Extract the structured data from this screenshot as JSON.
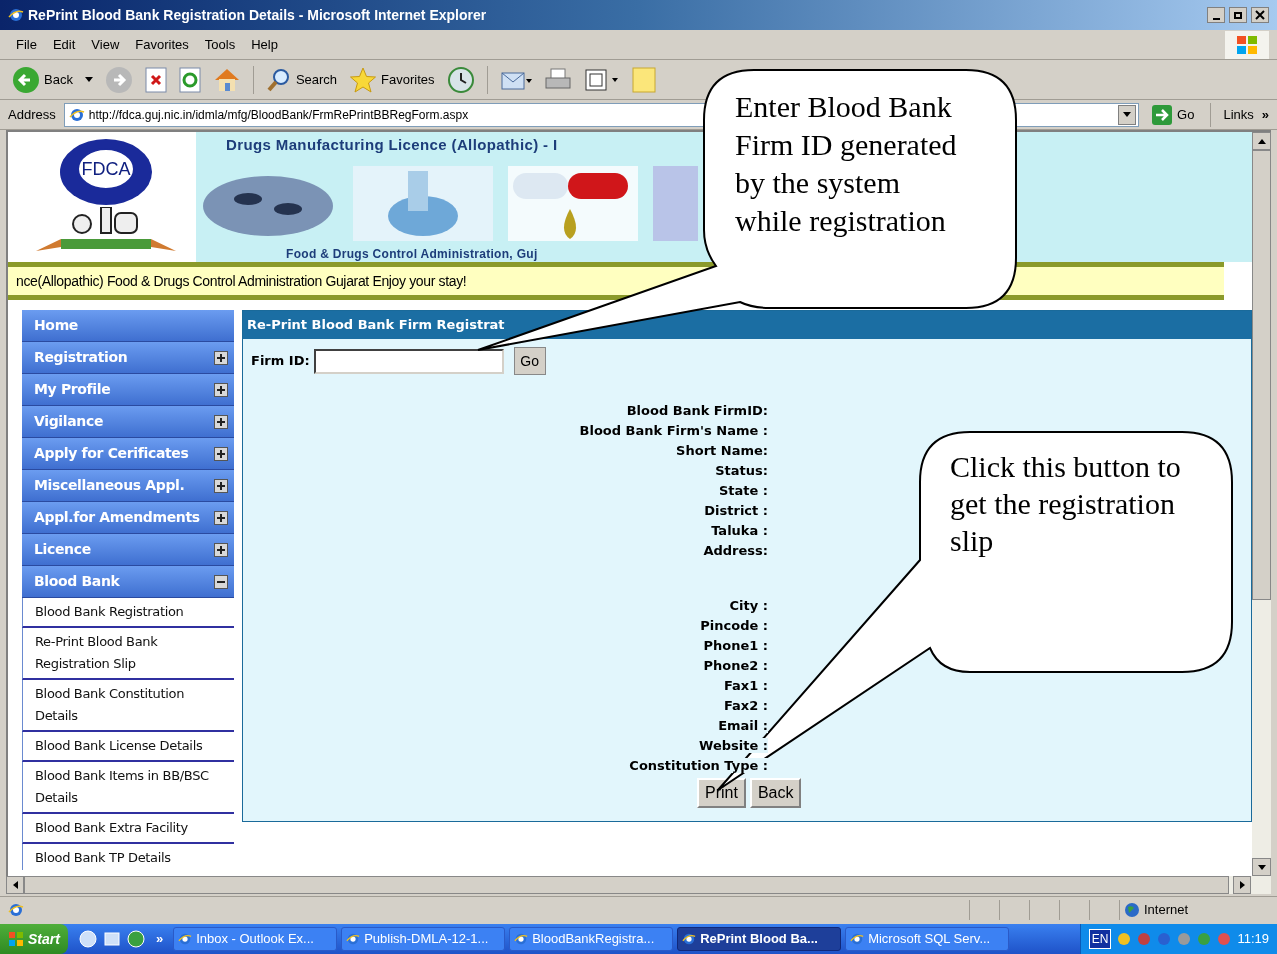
{
  "window": {
    "title": "RePrint Blood Bank Registration Details - Microsoft Internet Explorer"
  },
  "menu": [
    "File",
    "Edit",
    "View",
    "Favorites",
    "Tools",
    "Help"
  ],
  "toolbar": {
    "back": "Back",
    "search": "Search",
    "favorites": "Favorites"
  },
  "address": {
    "label": "Address",
    "url": "http://fdca.guj.nic.in/idmla/mfg/BloodBank/FrmRePrintBBRegForm.aspx",
    "go": "Go",
    "links": "Links",
    "more": "»"
  },
  "banner": {
    "logo": "FDCA",
    "title": "Drugs Manufacturing Licence (Allopathic) - I",
    "subtitle": "Food & Drugs Control Administration, Guj"
  },
  "marquee": "nce(Allopathic) Food & Drugs Control Administration Gujarat Enjoy your stay!",
  "sidebar": {
    "items": [
      {
        "label": "Home",
        "kind": "link"
      },
      {
        "label": "Registration",
        "kind": "group",
        "expanded": false
      },
      {
        "label": "My Profile",
        "kind": "group",
        "expanded": false
      },
      {
        "label": "Vigilance",
        "kind": "group",
        "expanded": false
      },
      {
        "label": "Apply for Cerificates",
        "kind": "group",
        "expanded": false
      },
      {
        "label": "Miscellaneous Appl.",
        "kind": "group",
        "expanded": false
      },
      {
        "label": "Appl.for Amendments",
        "kind": "group",
        "expanded": false
      },
      {
        "label": "Licence",
        "kind": "group",
        "expanded": false
      },
      {
        "label": "Blood Bank",
        "kind": "group",
        "expanded": true,
        "children": [
          {
            "label": "Blood Bank Registration"
          },
          {
            "label": "Re-Print Blood Bank Registration Slip"
          },
          {
            "label": "Blood Bank Constitution Details"
          },
          {
            "label": "Blood Bank License Details"
          },
          {
            "label": "Blood Bank Items in BB/BSC Details"
          },
          {
            "label": "Blood Bank Extra Facility"
          },
          {
            "label": "Blood Bank TP Details"
          }
        ]
      }
    ]
  },
  "form": {
    "title": "Re-Print Blood Bank Firm Registrat",
    "firm_id_label": "Firm ID:",
    "go": "Go",
    "fields": [
      {
        "label": "Blood Bank FirmID:",
        "kind": "line"
      },
      {
        "label": "Blood Bank Firm's Name :",
        "kind": "line"
      },
      {
        "label": "Short Name:",
        "kind": "line"
      },
      {
        "label": "Status:",
        "kind": "line"
      },
      {
        "label": "State :",
        "kind": "line"
      },
      {
        "label": "District :",
        "kind": "line"
      },
      {
        "label": "Taluka :",
        "kind": "line"
      },
      {
        "label": "Address:",
        "kind": "multiline"
      },
      {
        "label": "City :",
        "kind": "line"
      },
      {
        "label": "Pincode :",
        "kind": "line"
      },
      {
        "label": "Phone1 :",
        "kind": "line"
      },
      {
        "label": "Phone2 :",
        "kind": "line"
      },
      {
        "label": "Fax1 :",
        "kind": "line"
      },
      {
        "label": "Fax2 :",
        "kind": "line"
      },
      {
        "label": "Email :",
        "kind": "line"
      },
      {
        "label": "Website :",
        "kind": "line"
      },
      {
        "label": "Constitution Type :",
        "kind": "line"
      }
    ],
    "buttons": [
      "Print",
      "Back"
    ]
  },
  "status_bar": {
    "zone": "Internet"
  },
  "taskbar": {
    "start": "Start",
    "more": "»",
    "tasks": [
      {
        "label": "Inbox - Outlook Ex...",
        "selected": false
      },
      {
        "label": "Publish-DMLA-12-1...",
        "selected": false
      },
      {
        "label": "BloodBankRegistra...",
        "selected": false
      },
      {
        "label": "RePrint Blood Ba...",
        "selected": true
      },
      {
        "label": "Microsoft SQL Serv...",
        "selected": false
      }
    ],
    "lang": "EN",
    "clock": "11:19"
  },
  "callouts": [
    {
      "lines": [
        "Enter Blood Bank",
        "Firm ID generated",
        "by the system",
        "while registration"
      ]
    },
    {
      "lines": [
        "Click this button to",
        "get the registration",
        "slip"
      ]
    }
  ]
}
